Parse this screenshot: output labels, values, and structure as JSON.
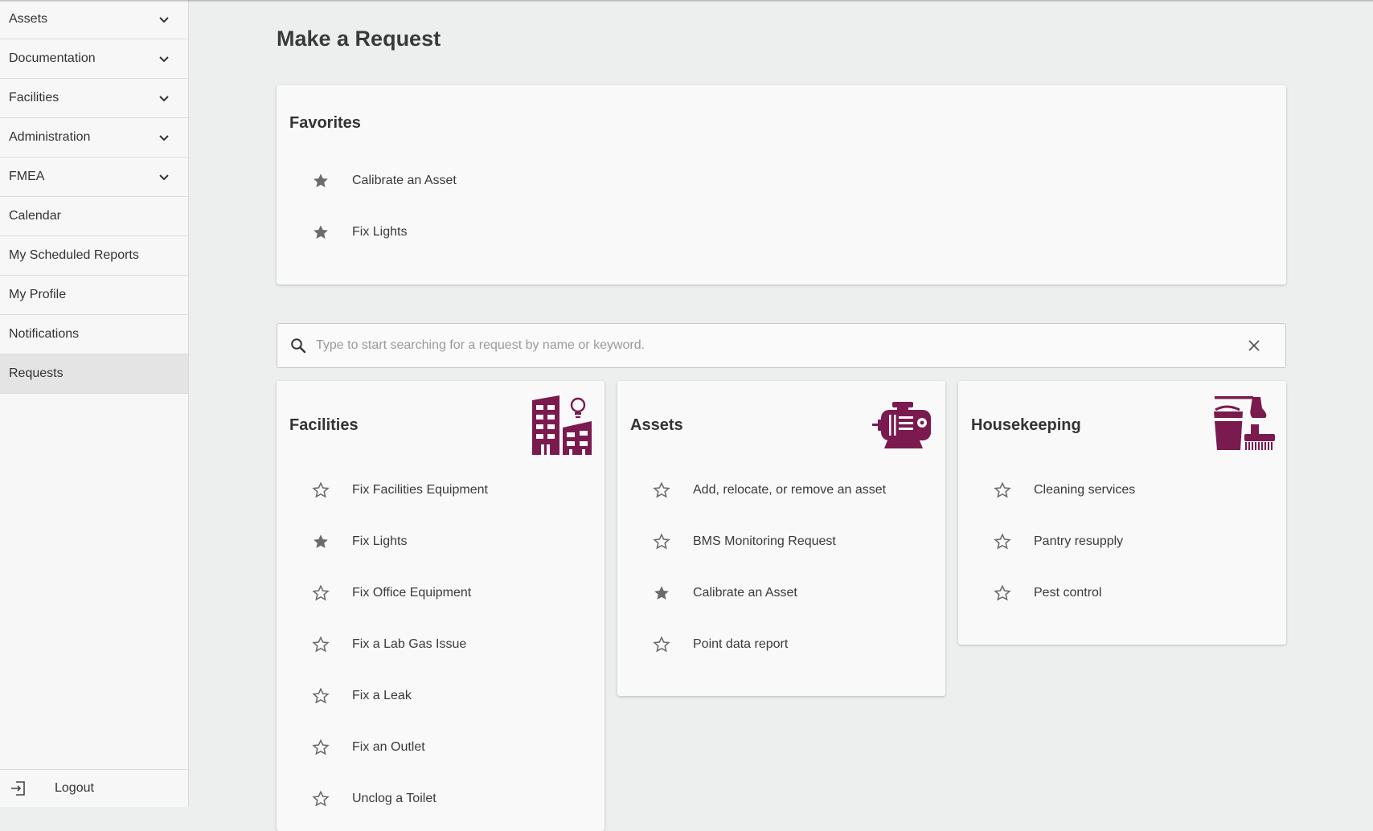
{
  "sidebar": {
    "items": [
      {
        "label": "Assets",
        "expandable": true
      },
      {
        "label": "Documentation",
        "expandable": true
      },
      {
        "label": "Facilities",
        "expandable": true
      },
      {
        "label": "Administration",
        "expandable": true
      },
      {
        "label": "FMEA",
        "expandable": true
      },
      {
        "label": "Calendar",
        "expandable": false
      },
      {
        "label": "My Scheduled Reports",
        "expandable": false
      },
      {
        "label": "My Profile",
        "expandable": false
      },
      {
        "label": "Notifications",
        "expandable": false
      },
      {
        "label": "Requests",
        "expandable": false,
        "active": true
      }
    ],
    "logout_label": "Logout"
  },
  "main": {
    "title": "Make a Request",
    "favorites": {
      "title": "Favorites",
      "items": [
        "Calibrate an Asset",
        "Fix Lights"
      ]
    },
    "search": {
      "placeholder": "Type to start searching for a request by name or keyword."
    },
    "categories": {
      "facilities": {
        "title": "Facilities",
        "icon": "buildings-icon",
        "items": [
          {
            "label": "Fix Facilities Equipment",
            "favorite": false
          },
          {
            "label": "Fix Lights",
            "favorite": true
          },
          {
            "label": "Fix Office Equipment",
            "favorite": false
          },
          {
            "label": "Fix a Lab Gas Issue",
            "favorite": false
          },
          {
            "label": "Fix a Leak",
            "favorite": false
          },
          {
            "label": "Fix an Outlet",
            "favorite": false
          },
          {
            "label": "Unclog a Toilet",
            "favorite": false
          }
        ]
      },
      "assets": {
        "title": "Assets",
        "icon": "motor-icon",
        "items": [
          {
            "label": "Add, relocate, or remove an asset",
            "favorite": false
          },
          {
            "label": "BMS Monitoring Request",
            "favorite": false
          },
          {
            "label": "Calibrate an Asset",
            "favorite": true
          },
          {
            "label": "Point data report",
            "favorite": false
          }
        ]
      },
      "housekeeping": {
        "title": "Housekeeping",
        "icon": "cleaning-supplies-icon",
        "items": [
          {
            "label": "Cleaning services",
            "favorite": false
          },
          {
            "label": "Pantry resupply",
            "favorite": false
          },
          {
            "label": "Pest control",
            "favorite": false
          }
        ]
      }
    }
  },
  "colors": {
    "accent": "#7a1a4f",
    "star": "#6b6b6b",
    "background": "#ecefee"
  }
}
